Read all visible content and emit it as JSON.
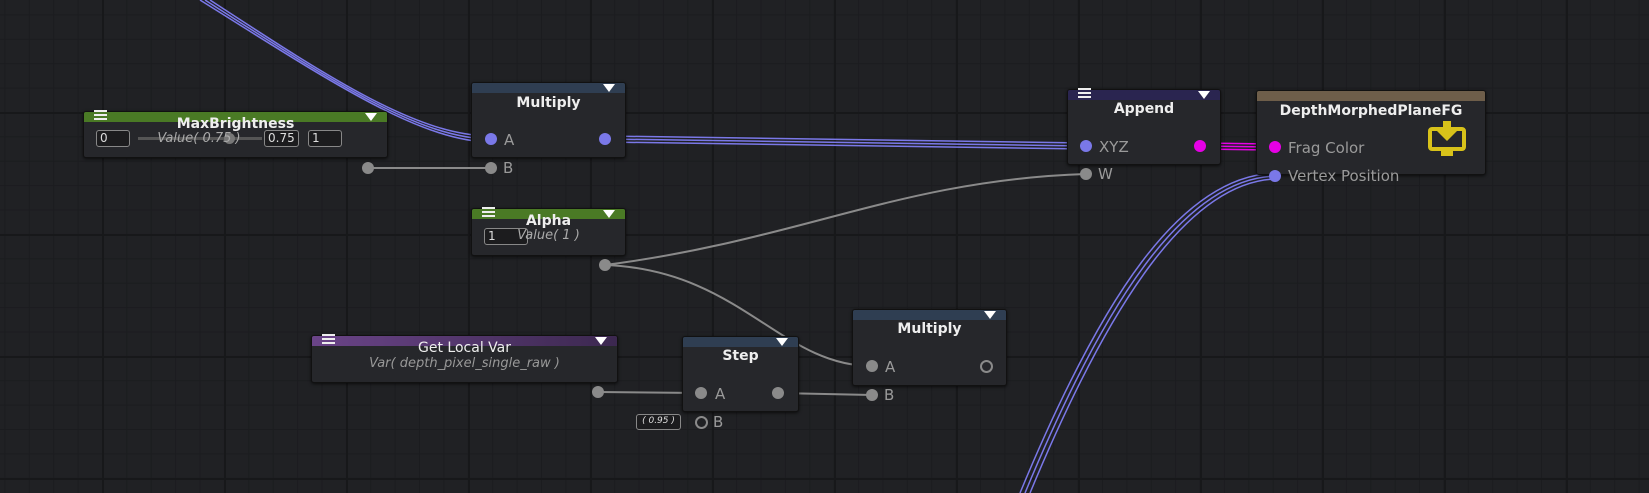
{
  "nodes": {
    "max_brightness": {
      "title": "MaxBrightness",
      "min": "0",
      "value_label": "Value( 0.75 )",
      "value": "0.75",
      "max": "1",
      "slider_fraction": 0.75
    },
    "multiply1": {
      "title": "Multiply",
      "in_a": "A",
      "in_b": "B"
    },
    "alpha": {
      "title": "Alpha",
      "value": "1",
      "value_label": "Value( 1 )"
    },
    "append": {
      "title": "Append",
      "in_xyz": "XYZ",
      "in_w": "W"
    },
    "output": {
      "title": "DepthMorphedPlaneFG",
      "in_frag": "Frag Color",
      "in_vertex": "Vertex Position"
    },
    "get_local_var": {
      "title": "Get Local Var",
      "sub": "Var( depth_pixel_single_raw )"
    },
    "step": {
      "title": "Step",
      "in_a": "A",
      "in_b": "B",
      "b_default": "( 0.95 )"
    },
    "multiply2": {
      "title": "Multiply",
      "in_a": "A",
      "in_b": "B"
    }
  },
  "colors": {
    "float_header": "#4a7a25",
    "op_header": "#2f3e52",
    "append_header": "#2a2550",
    "output_header": "#6e5e4a",
    "var_header": "#5c3c78",
    "wire_vec": "#7a78e8",
    "wire_color": "#e600e6",
    "wire_float": "#8a8a8a"
  }
}
